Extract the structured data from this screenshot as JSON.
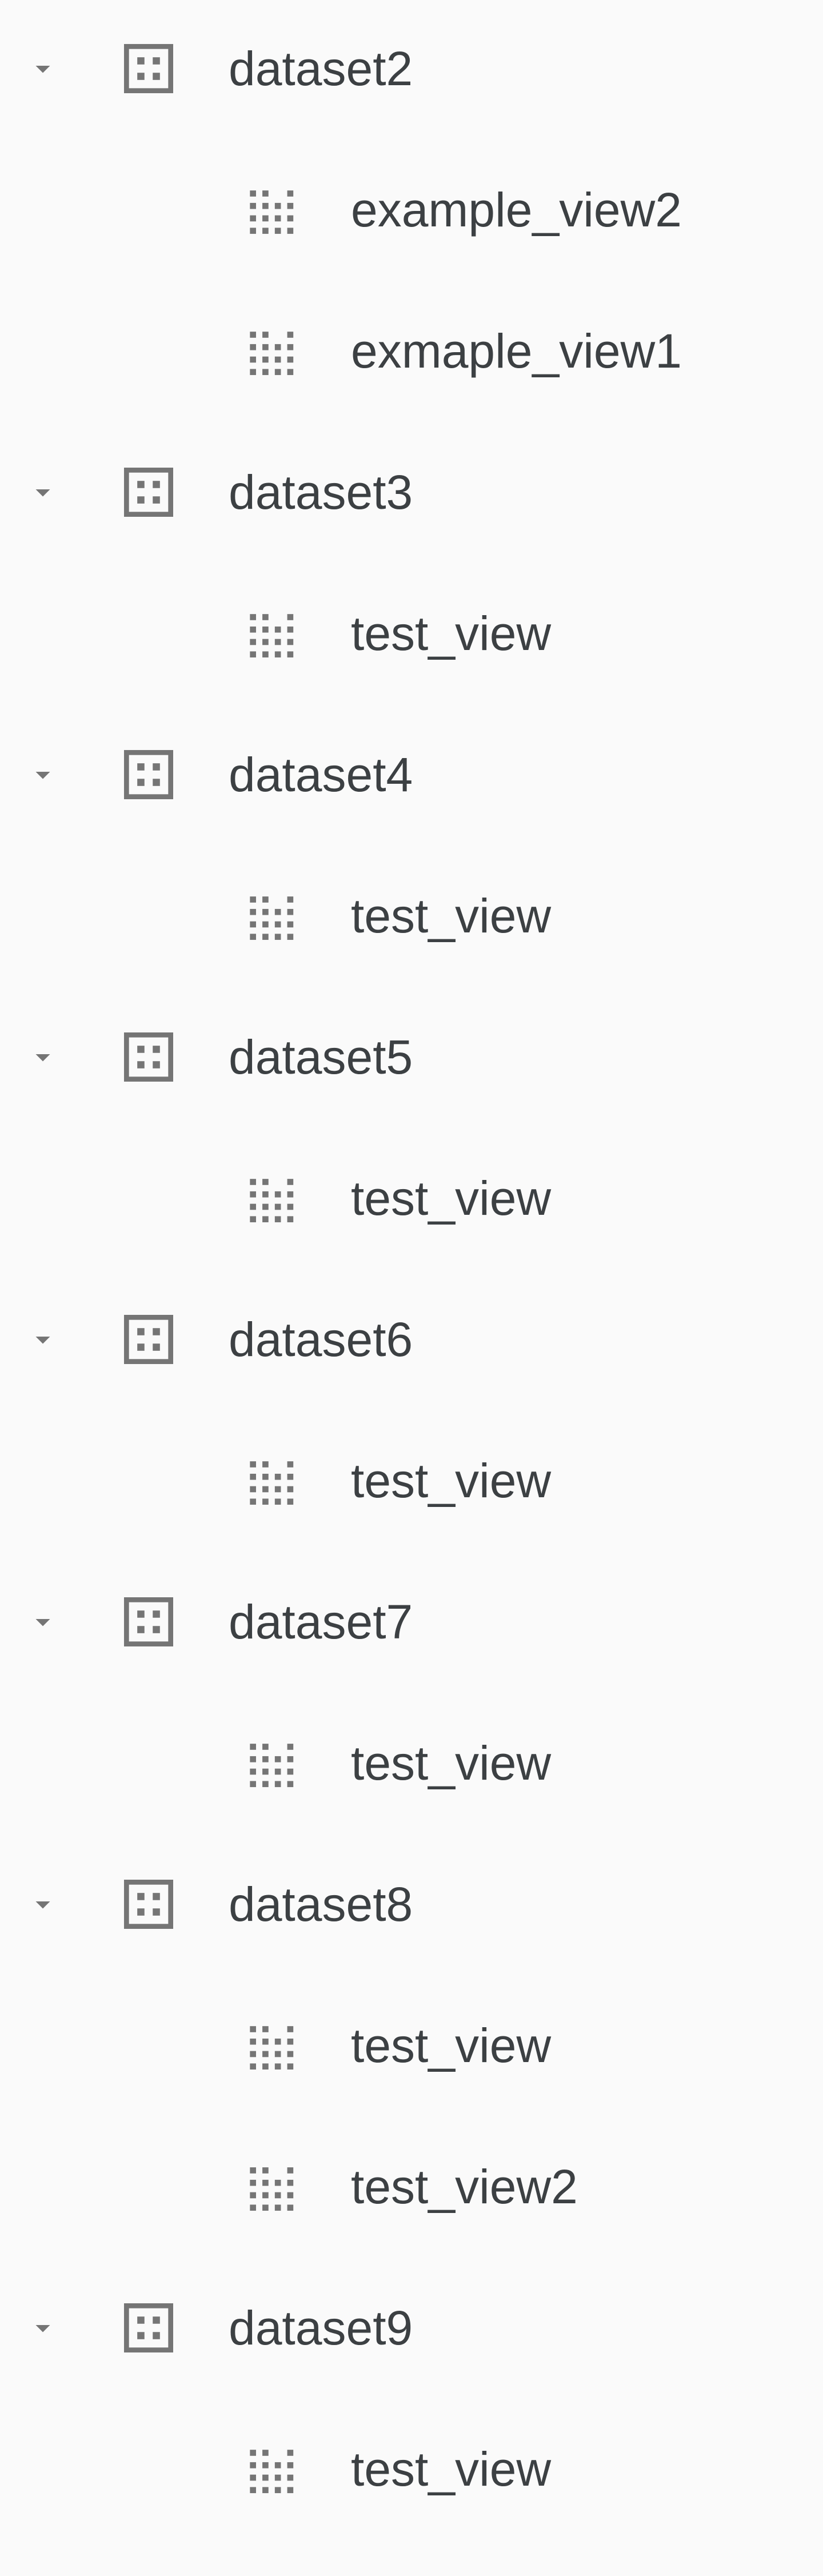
{
  "colors": {
    "background": "#fafafa",
    "text": "#3c4043",
    "icon": "#757575"
  },
  "icons": {
    "expand": "arrow-drop-down-icon",
    "dataset": "dataset-icon",
    "view": "view-icon"
  },
  "tree": [
    {
      "label": "dataset2",
      "expanded": true,
      "children": [
        "example_view2",
        "exmaple_view1"
      ]
    },
    {
      "label": "dataset3",
      "expanded": true,
      "children": [
        "test_view"
      ]
    },
    {
      "label": "dataset4",
      "expanded": true,
      "children": [
        "test_view"
      ]
    },
    {
      "label": "dataset5",
      "expanded": true,
      "children": [
        "test_view"
      ]
    },
    {
      "label": "dataset6",
      "expanded": true,
      "children": [
        "test_view"
      ]
    },
    {
      "label": "dataset7",
      "expanded": true,
      "children": [
        "test_view"
      ]
    },
    {
      "label": "dataset8",
      "expanded": true,
      "children": [
        "test_view",
        "test_view2"
      ]
    },
    {
      "label": "dataset9",
      "expanded": true,
      "children": [
        "test_view"
      ]
    }
  ]
}
